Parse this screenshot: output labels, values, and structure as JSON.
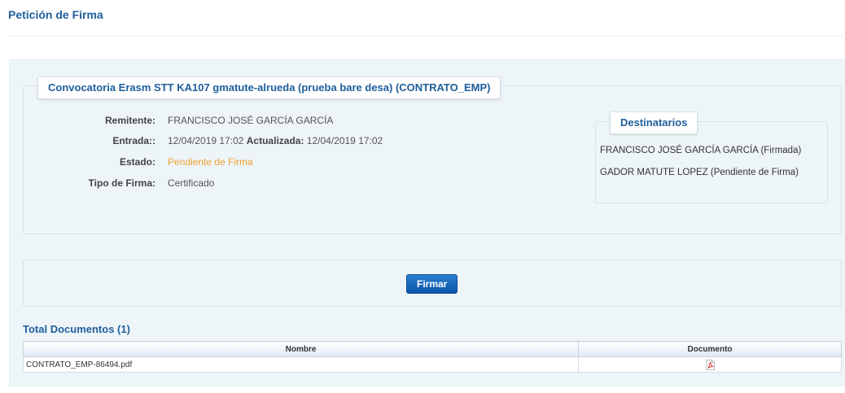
{
  "page": {
    "title": "Petición de Firma"
  },
  "request": {
    "legend": "Convocatoria Erasm STT KA107 gmatute-alrueda (prueba bare desa) (CONTRATO_EMP)",
    "fields": {
      "sender_label": "Remitente:",
      "sender_value": "FRANCISCO JOSÉ GARCÍA GARCÍA",
      "entry_label": "Entrada::",
      "entry_value": "12/04/2019 17:02",
      "updated_label": "Actualizada:",
      "updated_value": "12/04/2019 17:02",
      "status_label": "Estado:",
      "status_value": "Pendiente de Firma",
      "sign_type_label": "Tipo de Firma:",
      "sign_type_value": "Certificado"
    },
    "recipients": {
      "legend": "Destinatarios",
      "items": [
        "FRANCISCO JOSÉ GARCÍA GARCÍA (Firmada)",
        "GADOR MATUTE LOPEZ (Pendiente de Firma)"
      ]
    }
  },
  "actions": {
    "sign_label": "Firmar"
  },
  "documents": {
    "title": "Total Documentos (1)",
    "columns": [
      "Nombre",
      "Documento"
    ],
    "rows": [
      {
        "name": "CONTRATO_EMP-86494.pdf",
        "icon": "pdf-icon"
      }
    ]
  },
  "colors": {
    "accent": "#1f5e9c",
    "pending": "#f0a030",
    "button": "#0b55a8",
    "pdf_icon": "#d9322b"
  }
}
